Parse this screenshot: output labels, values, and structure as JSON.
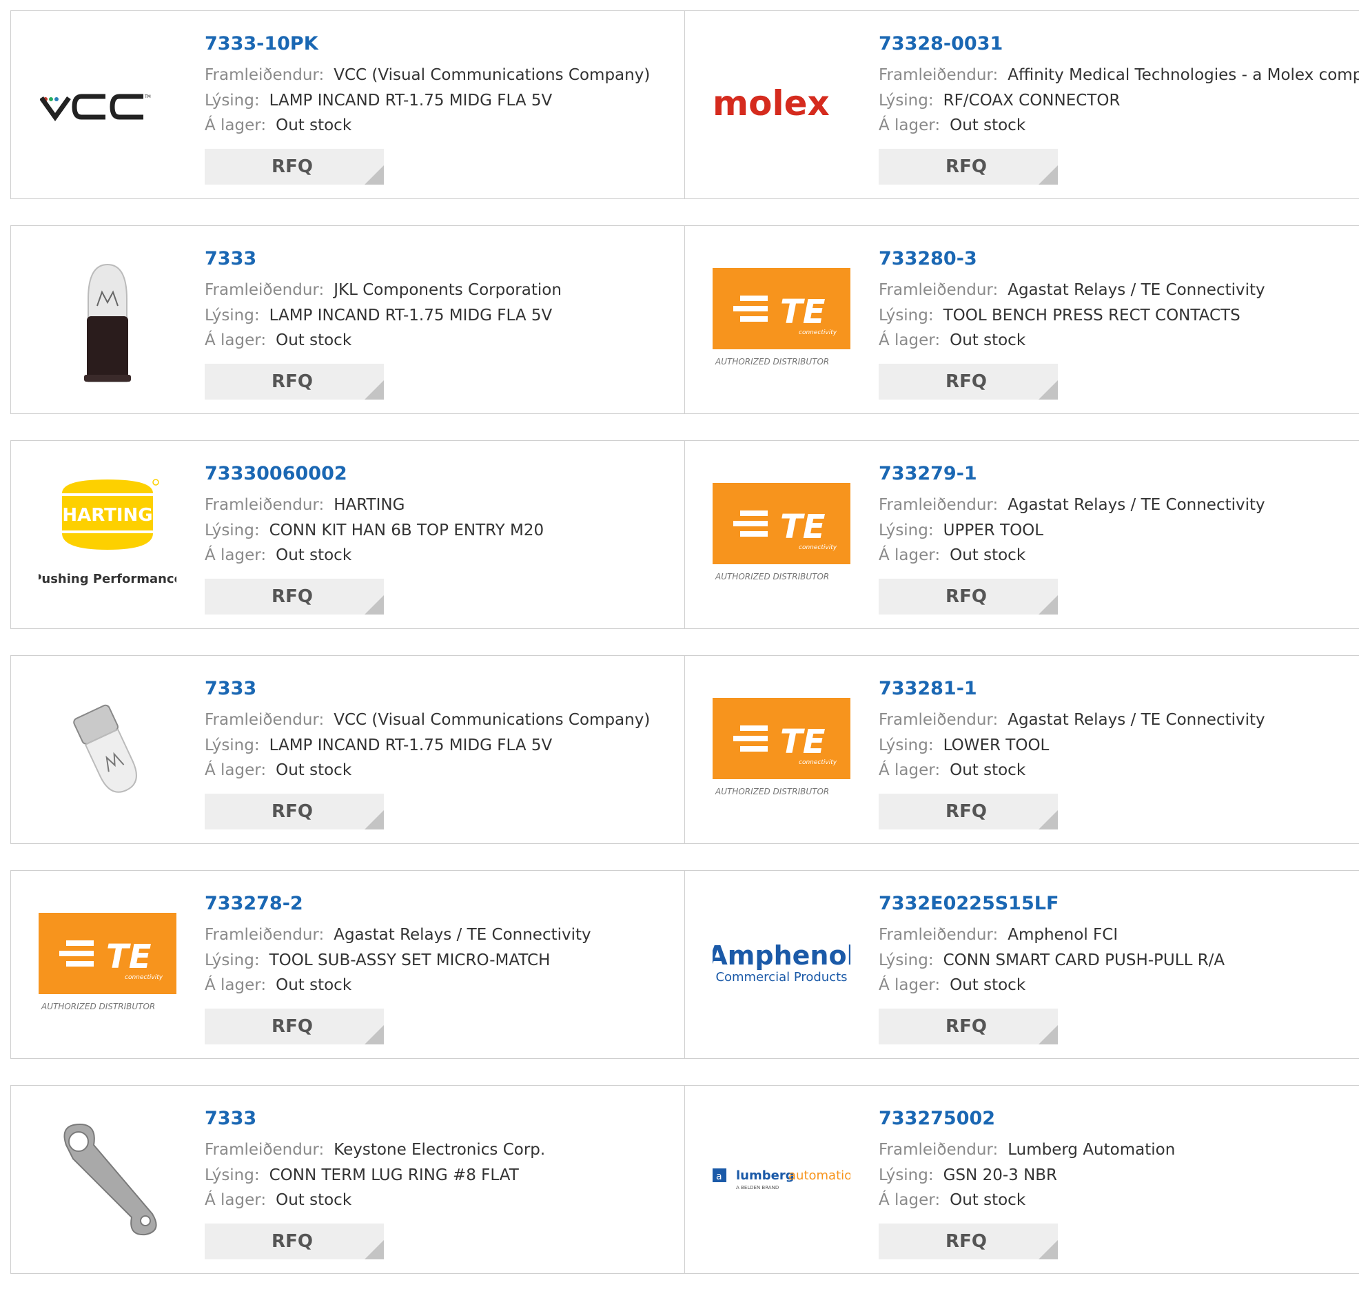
{
  "labels": {
    "manufacturer": "Framleiðendur:",
    "description": "Lýsing:",
    "stock": "Á lager:",
    "rfq": "RFQ"
  },
  "products": [
    {
      "part": "7333-10PK",
      "manufacturer": "VCC (Visual Communications Company)",
      "description": "LAMP INCAND RT-1.75 MIDG FLA 5V",
      "stock": "Out stock",
      "logo": "vcc-logo"
    },
    {
      "part": "73328-0031",
      "manufacturer": "Affinity Medical Technologies - a Molex company",
      "description": "RF/COAX CONNECTOR",
      "stock": "Out stock",
      "logo": "molex-logo"
    },
    {
      "part": "7333",
      "manufacturer": "JKL Components Corporation",
      "description": "LAMP INCAND RT-1.75 MIDG FLA 5V",
      "stock": "Out stock",
      "logo": "lamp-bulb-photo"
    },
    {
      "part": "733280-3",
      "manufacturer": "Agastat Relays / TE Connectivity",
      "description": "TOOL BENCH PRESS RECT CONTACTS",
      "stock": "Out stock",
      "logo": "te-connectivity-logo"
    },
    {
      "part": "73330060002",
      "manufacturer": "HARTING",
      "description": "CONN KIT HAN 6B TOP ENTRY M20",
      "stock": "Out stock",
      "logo": "harting-logo"
    },
    {
      "part": "733279-1",
      "manufacturer": "Agastat Relays / TE Connectivity",
      "description": "UPPER TOOL",
      "stock": "Out stock",
      "logo": "te-connectivity-logo"
    },
    {
      "part": "7333",
      "manufacturer": "VCC (Visual Communications Company)",
      "description": "LAMP INCAND RT-1.75 MIDG FLA 5V",
      "stock": "Out stock",
      "logo": "lamp-bulb-photo"
    },
    {
      "part": "733281-1",
      "manufacturer": "Agastat Relays / TE Connectivity",
      "description": "LOWER TOOL",
      "stock": "Out stock",
      "logo": "te-connectivity-logo"
    },
    {
      "part": "733278-2",
      "manufacturer": "Agastat Relays / TE Connectivity",
      "description": "TOOL SUB-ASSY SET MICRO-MATCH",
      "stock": "Out stock",
      "logo": "te-connectivity-logo"
    },
    {
      "part": "7332E0225S15LF",
      "manufacturer": "Amphenol FCI",
      "description": "CONN SMART CARD PUSH-PULL R/A",
      "stock": "Out stock",
      "logo": "amphenol-logo"
    },
    {
      "part": "7333",
      "manufacturer": "Keystone Electronics Corp.",
      "description": "CONN TERM LUG RING #8 FLAT",
      "stock": "Out stock",
      "logo": "ring-lug-photo"
    },
    {
      "part": "733275002",
      "manufacturer": "Lumberg Automation",
      "description": "GSN 20-3 NBR",
      "stock": "Out stock",
      "logo": "lumberg-automation-logo"
    }
  ],
  "logo_text": {
    "vcc": "VCC",
    "molex": "molex",
    "te": "TE",
    "te_sub": "connectivity",
    "te_auth": "AUTHORIZED DISTRIBUTOR",
    "harting": "HARTING",
    "harting_tag": "Pushing Performance",
    "amphenol": "Amphenol",
    "amphenol_sub": "Commercial Products",
    "lumberg_a": "lumberg",
    "lumberg_b": "automation",
    "lumberg_sub": "A BELDEN BRAND"
  },
  "colors": {
    "link": "#1a67b3",
    "te_orange": "#f7941d",
    "molex_red": "#d52b1e",
    "harting_yellow": "#fdd000",
    "amphenol_blue": "#1b5aa8"
  }
}
